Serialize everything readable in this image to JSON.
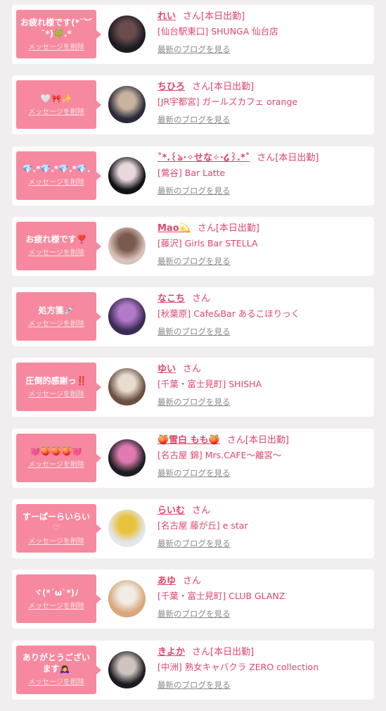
{
  "delete_label": "メッセージを削除",
  "blog_label": "最新のブログを見る",
  "san_label": "さん",
  "colors": {
    "bubble": "#f6899f",
    "accent": "#e0456c",
    "card": "#ffffff",
    "page_bg": "#f1eeef"
  },
  "entries": [
    {
      "message": "お疲れ様です(*˘︶˘*)🍀.*",
      "name": "れい",
      "status": "[本日出勤]",
      "store": "[仙台駅東口] SHUNGA 仙台店",
      "avatar": [
        "#1c1c24",
        "#6b4c4c"
      ]
    },
    {
      "message": "🤍🎀✨",
      "name": "ちひろ",
      "status": "[本日出勤]",
      "store": "[JR宇都宮] ガールズカフェ orange",
      "avatar": [
        "#2a2a3a",
        "#c9b3a0"
      ]
    },
    {
      "message": "💎.*💎.*💎.*💎.",
      "name": "˚*.꒰ঌ·✧せな✧·໒꒱.*˚",
      "status": "[本日出勤]",
      "store": "[鶯谷] Bar Latte",
      "avatar": [
        "#111118",
        "#e8d8dc"
      ]
    },
    {
      "message": "お疲れ様です❣️",
      "name": "Mao💫",
      "status": "[本日出勤]",
      "store": "[藤沢] Girls Bar STELLA",
      "avatar": [
        "#d9c2b8",
        "#7a5a4e"
      ]
    },
    {
      "message": "処方箋💉",
      "name": "なこち",
      "status": "",
      "store": "[秋葉原] Cafe&Bar あるこほりっく",
      "avatar": [
        "#3b2a55",
        "#b27ac8"
      ]
    },
    {
      "message": "圧倒的感謝っ‼️",
      "name": "ゆい",
      "status": "",
      "store": "[千葉・富士見町] SHISHA",
      "avatar": [
        "#6a5040",
        "#e8dcd0"
      ]
    },
    {
      "message": "💓🍑🍑🍑💓",
      "name": "🍑雪白 もも🍑",
      "status": "[本日出勤]",
      "store": "[名古屋 錦] Mrs.CAFE〜離宮〜",
      "avatar": [
        "#1e1e22",
        "#e07ab0"
      ]
    },
    {
      "message": "すーぱーらいらい♡",
      "name": "らいむ",
      "status": "",
      "store": "[名古屋 藤が丘] e star",
      "avatar": [
        "#e2e6ef",
        "#e8c23a"
      ]
    },
    {
      "message": "ヾ(*´ω`*)ﾉ",
      "name": "あゆ",
      "status": "",
      "store": "[千葉・富士見町] CLUB GLANZ",
      "avatar": [
        "#d8a77a",
        "#f1ece6"
      ]
    },
    {
      "message": "ありがとうございます🙇‍♀️",
      "name": "きよか",
      "status": "[本日出勤]",
      "store": "[中洲] 熟女キャバクラ ZERO collection",
      "avatar": [
        "#1a1a20",
        "#cfc3bd"
      ]
    }
  ]
}
